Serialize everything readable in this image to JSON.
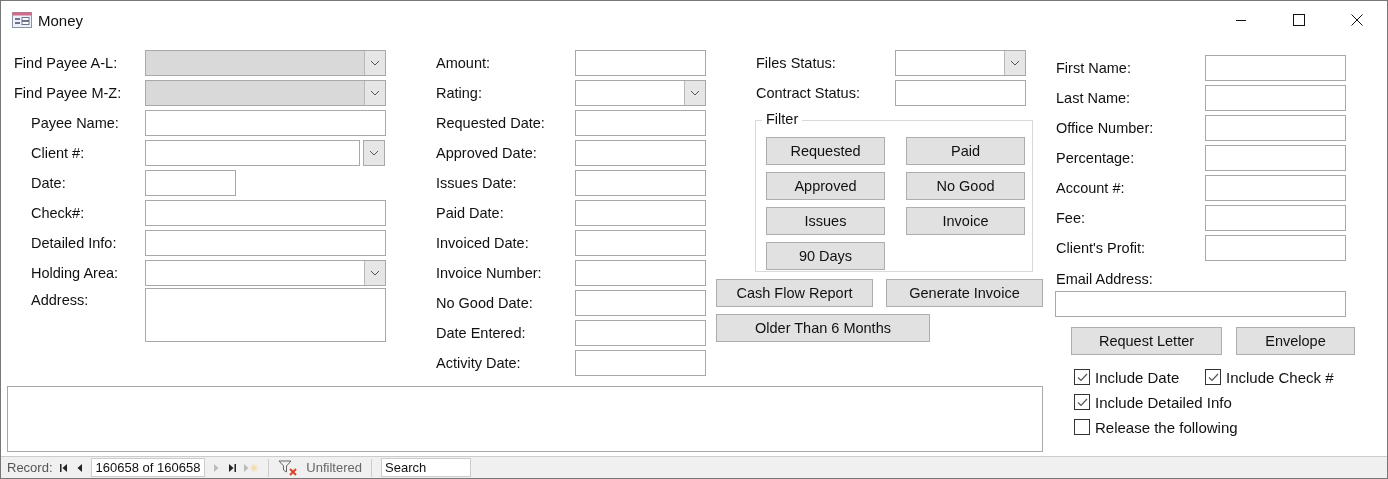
{
  "window": {
    "title": "Money"
  },
  "find_payee": [
    {
      "label": "Find Payee A-L:",
      "disabled": true
    },
    {
      "label": "Find Payee M-Z:",
      "disabled": true
    }
  ],
  "payee_fields": [
    {
      "label": "Payee Name:",
      "kind": "text"
    },
    {
      "label": "Client #:",
      "kind": "split_combo"
    },
    {
      "label": "Date:",
      "kind": "short"
    },
    {
      "label": "Check#:",
      "kind": "text"
    },
    {
      "label": "Detailed Info:",
      "kind": "text"
    },
    {
      "label": "Holding Area:",
      "kind": "combo"
    },
    {
      "label": "Address:",
      "kind": "memo"
    }
  ],
  "date_fields": [
    {
      "label": "Amount:",
      "kind": "text"
    },
    {
      "label": "Rating:",
      "kind": "combo"
    },
    {
      "label": "Requested Date:",
      "kind": "text"
    },
    {
      "label": "Approved Date:",
      "kind": "text"
    },
    {
      "label": "Issues Date:",
      "kind": "text"
    },
    {
      "label": "Paid Date:",
      "kind": "text"
    },
    {
      "label": "Invoiced Date:",
      "kind": "text"
    },
    {
      "label": "Invoice Number:",
      "kind": "text"
    },
    {
      "label": "No Good Date:",
      "kind": "text"
    },
    {
      "label": "Date Entered:",
      "kind": "text"
    },
    {
      "label": "Activity Date:",
      "kind": "text"
    }
  ],
  "status_fields": [
    {
      "label": "Files Status:",
      "kind": "combo"
    },
    {
      "label": "Contract Status:",
      "kind": "text"
    }
  ],
  "filter": {
    "title": "Filter",
    "buttons": [
      "Requested",
      "Paid",
      "Approved",
      "No Good",
      "Issues",
      "Invoice",
      "90 Days"
    ]
  },
  "report_buttons": [
    "Cash Flow Report",
    "Generate Invoice",
    "Older Than 6 Months"
  ],
  "contact_fields": [
    {
      "label": "First Name:"
    },
    {
      "label": "Last Name:"
    },
    {
      "label": "Office Number:"
    },
    {
      "label": "Percentage:"
    },
    {
      "label": "Account #:"
    },
    {
      "label": "Fee:"
    },
    {
      "label": "Client's Profit:"
    }
  ],
  "email": {
    "label": "Email Address:"
  },
  "letter_buttons": [
    "Request Letter",
    "Envelope"
  ],
  "options": [
    {
      "label": "Include Date",
      "checked": true
    },
    {
      "label": "Include Check #",
      "checked": true
    },
    {
      "label": "Include Detailed Info",
      "checked": true
    },
    {
      "label": "Release the following",
      "checked": false
    }
  ],
  "status_bar": {
    "record_label": "Record:",
    "position": "160658 of 160658",
    "filter_state": "Unfiltered",
    "search": {
      "placeholder": "Search"
    }
  }
}
